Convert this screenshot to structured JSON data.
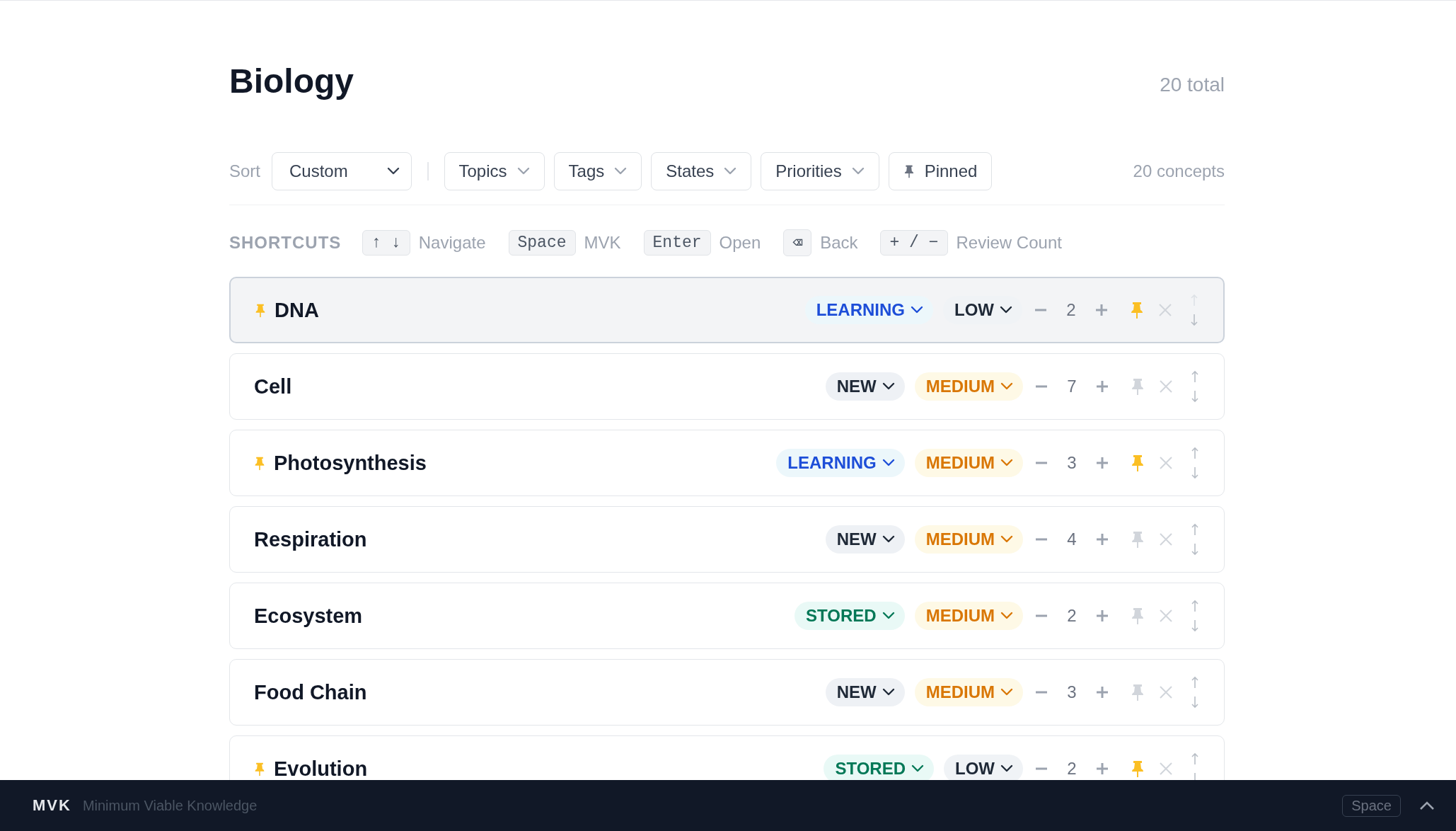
{
  "page": {
    "title": "Biology",
    "total": "20 total"
  },
  "toolbar": {
    "sort_label": "Sort",
    "sort": {
      "value": "Custom"
    },
    "filters": [
      {
        "label": "Topics"
      },
      {
        "label": "Tags"
      },
      {
        "label": "States"
      },
      {
        "label": "Priorities"
      }
    ],
    "pinned_filter": {
      "label": "Pinned",
      "on": false
    },
    "count": "20 concepts"
  },
  "shortcuts": {
    "title": "SHORTCUTS",
    "items": [
      {
        "key": "↑ ↓",
        "label": "Navigate"
      },
      {
        "key": "Space",
        "label": "MVK"
      },
      {
        "key": "Enter",
        "label": "Open"
      },
      {
        "key": "⌫",
        "label": "Back"
      },
      {
        "key": "+ / −",
        "label": "Review Count"
      }
    ]
  },
  "rows": [
    {
      "name": "DNA",
      "pinned": true,
      "selected": true,
      "state": {
        "label": "LEARNING",
        "kind": "learning"
      },
      "priority": {
        "label": "LOW",
        "kind": "low"
      },
      "count": "2",
      "move_up_disabled": true
    },
    {
      "name": "Cell",
      "pinned": false,
      "selected": false,
      "state": {
        "label": "NEW",
        "kind": "new"
      },
      "priority": {
        "label": "MEDIUM",
        "kind": "medium"
      },
      "count": "7",
      "move_up_disabled": false
    },
    {
      "name": "Photosynthesis",
      "pinned": true,
      "selected": false,
      "state": {
        "label": "LEARNING",
        "kind": "learning"
      },
      "priority": {
        "label": "MEDIUM",
        "kind": "medium"
      },
      "count": "3",
      "move_up_disabled": false
    },
    {
      "name": "Respiration",
      "pinned": false,
      "selected": false,
      "state": {
        "label": "NEW",
        "kind": "new"
      },
      "priority": {
        "label": "MEDIUM",
        "kind": "medium"
      },
      "count": "4",
      "move_up_disabled": false
    },
    {
      "name": "Ecosystem",
      "pinned": false,
      "selected": false,
      "state": {
        "label": "STORED",
        "kind": "stored"
      },
      "priority": {
        "label": "MEDIUM",
        "kind": "medium"
      },
      "count": "2",
      "move_up_disabled": false
    },
    {
      "name": "Food Chain",
      "pinned": false,
      "selected": false,
      "state": {
        "label": "NEW",
        "kind": "new"
      },
      "priority": {
        "label": "MEDIUM",
        "kind": "medium"
      },
      "count": "3",
      "move_up_disabled": false
    },
    {
      "name": "Evolution",
      "pinned": true,
      "selected": false,
      "state": {
        "label": "STORED",
        "kind": "stored"
      },
      "priority": {
        "label": "LOW",
        "kind": "low"
      },
      "count": "2",
      "move_up_disabled": false
    }
  ],
  "footer": {
    "brand": "MVK",
    "tagline": "Minimum Viable Knowledge",
    "key": "Space"
  }
}
